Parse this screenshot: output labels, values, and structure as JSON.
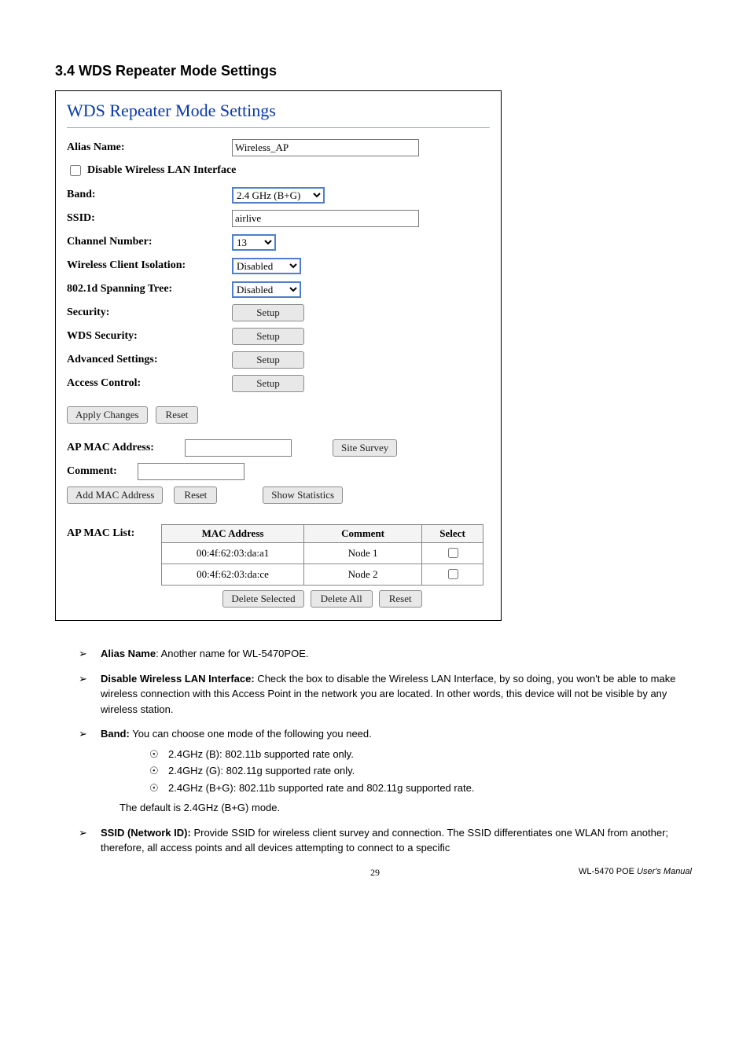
{
  "heading": "3.4 WDS Repeater Mode Settings",
  "panel": {
    "title": "WDS Repeater Mode Settings",
    "alias_label": "Alias Name:",
    "alias_value": "Wireless_AP",
    "disable_label": "Disable Wireless LAN Interface",
    "band_label": "Band:",
    "band_value": "2.4 GHz (B+G)",
    "ssid_label": "SSID:",
    "ssid_value": "airlive",
    "channel_label": "Channel Number:",
    "channel_value": "13",
    "wci_label": "Wireless Client Isolation:",
    "wci_value": "Disabled",
    "stp_label": "802.1d Spanning Tree:",
    "stp_value": "Disabled",
    "security_label": "Security:",
    "wds_security_label": "WDS Security:",
    "advanced_label": "Advanced Settings:",
    "access_label": "Access Control:",
    "setup_btn": "Setup",
    "apply_btn": "Apply Changes",
    "reset_btn": "Reset",
    "ap_mac_label": "AP MAC Address:",
    "site_survey_btn": "Site Survey",
    "comment_label": "Comment:",
    "add_mac_btn": "Add MAC Address",
    "show_stats_btn": "Show Statistics",
    "ap_mac_list_label": "AP MAC List:",
    "th_mac": "MAC Address",
    "th_comment": "Comment",
    "th_select": "Select",
    "rows": [
      {
        "mac": "00:4f:62:03:da:a1",
        "comment": "Node 1"
      },
      {
        "mac": "00:4f:62:03:da:ce",
        "comment": "Node 2"
      }
    ],
    "delete_selected_btn": "Delete Selected",
    "delete_all_btn": "Delete All"
  },
  "desc": {
    "alias_b": "Alias Name",
    "alias_t": ": Another name for WL-5470POE.",
    "disable_b": "Disable Wireless LAN Interface:",
    "disable_t": " Check the box to disable the Wireless LAN Interface, by so doing, you won't be able to make wireless connection with this Access Point in the network you are located. In other words, this device will not be visible by any wireless station.",
    "band_b": "Band:",
    "band_t": " You can choose one mode of the following you need.",
    "band_sub": [
      "   2.4GHz (B): 802.11b supported rate only.",
      "2.4GHz (G): 802.11g supported rate only.",
      "   2.4GHz (B+G): 802.11b supported rate and 802.11g supported rate."
    ],
    "band_default": "The default is 2.4GHz (B+G) mode.",
    "ssid_b": "SSID (Network ID):",
    "ssid_t": " Provide SSID for wireless client survey and connection. The SSID differentiates one WLAN from another; therefore, all access points and all devices attempting to connect to a specific"
  },
  "footer": {
    "page": "29",
    "right1": "WL-5470 POE ",
    "right2": "User's Manual"
  }
}
